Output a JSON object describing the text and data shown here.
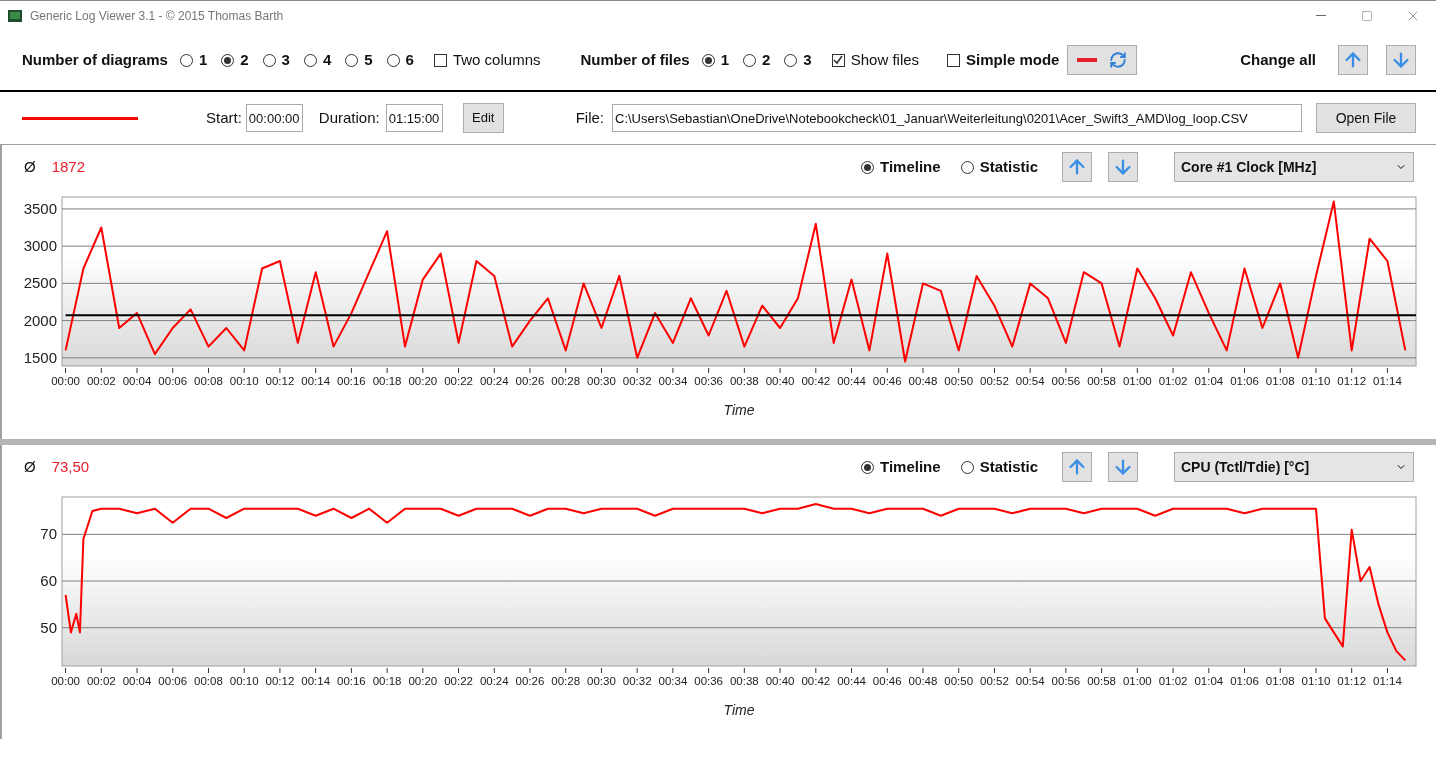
{
  "window": {
    "title": "Generic Log Viewer 3.1 - © 2015 Thomas Barth"
  },
  "toolbar": {
    "diagrams": {
      "label": "Number of diagrams",
      "options": [
        {
          "label": "1",
          "selected": false
        },
        {
          "label": "2",
          "selected": true
        },
        {
          "label": "3",
          "selected": false
        },
        {
          "label": "4",
          "selected": false
        },
        {
          "label": "5",
          "selected": false
        },
        {
          "label": "6",
          "selected": false
        }
      ]
    },
    "two_columns": {
      "label": "Two columns",
      "checked": false
    },
    "files": {
      "label": "Number of files",
      "options": [
        {
          "label": "1",
          "selected": true
        },
        {
          "label": "2",
          "selected": false
        },
        {
          "label": "3",
          "selected": false
        }
      ]
    },
    "show_files": {
      "label": "Show files",
      "checked": true
    },
    "simple_mode": {
      "label": "Simple mode",
      "checked": false
    },
    "change_all": {
      "label": "Change all"
    }
  },
  "file": {
    "color": "#ff0000",
    "start_label": "Start:",
    "start": "00:00:00",
    "duration_label": "Duration:",
    "duration": "01:15:00",
    "edit_button": "Edit",
    "file_label": "File:",
    "path": "C:\\Users\\Sebastian\\OneDrive\\Notebookcheck\\01_Januar\\Weiterleitung\\0201\\Acer_Swift3_AMD\\log_loop.CSV",
    "open_button": "Open File"
  },
  "diagrams": [
    {
      "average_symbol": "Ø",
      "average": "1872",
      "views": [
        {
          "label": "Timeline",
          "selected": true
        },
        {
          "label": "Statistic",
          "selected": false
        }
      ],
      "chart_data": {
        "type": "line",
        "xlabel": "Time",
        "xlim": [
          -0.2,
          75.6
        ],
        "ylim": [
          1390,
          3660
        ],
        "yticks": [
          1500,
          2000,
          2500,
          3000,
          3500
        ],
        "xticks": [
          {
            "value": 0,
            "label": "00:00"
          },
          {
            "value": 2,
            "label": "00:02"
          },
          {
            "value": 4,
            "label": "00:04"
          },
          {
            "value": 6,
            "label": "00:06"
          },
          {
            "value": 8,
            "label": "00:08"
          },
          {
            "value": 10,
            "label": "00:10"
          },
          {
            "value": 12,
            "label": "00:12"
          },
          {
            "value": 14,
            "label": "00:14"
          },
          {
            "value": 16,
            "label": "00:16"
          },
          {
            "value": 18,
            "label": "00:18"
          },
          {
            "value": 20,
            "label": "00:20"
          },
          {
            "value": 22,
            "label": "00:22"
          },
          {
            "value": 24,
            "label": "00:24"
          },
          {
            "value": 26,
            "label": "00:26"
          },
          {
            "value": 28,
            "label": "00:28"
          },
          {
            "value": 30,
            "label": "00:30"
          },
          {
            "value": 32,
            "label": "00:32"
          },
          {
            "value": 34,
            "label": "00:34"
          },
          {
            "value": 36,
            "label": "00:36"
          },
          {
            "value": 38,
            "label": "00:38"
          },
          {
            "value": 40,
            "label": "00:40"
          },
          {
            "value": 42,
            "label": "00:42"
          },
          {
            "value": 44,
            "label": "00:44"
          },
          {
            "value": 46,
            "label": "00:46"
          },
          {
            "value": 48,
            "label": "00:48"
          },
          {
            "value": 50,
            "label": "00:50"
          },
          {
            "value": 52,
            "label": "00:52"
          },
          {
            "value": 54,
            "label": "00:54"
          },
          {
            "value": 56,
            "label": "00:56"
          },
          {
            "value": 58,
            "label": "00:58"
          },
          {
            "value": 60,
            "label": "01:00"
          },
          {
            "value": 62,
            "label": "01:02"
          },
          {
            "value": 64,
            "label": "01:04"
          },
          {
            "value": 66,
            "label": "01:06"
          },
          {
            "value": 68,
            "label": "01:08"
          },
          {
            "value": 70,
            "label": "01:10"
          },
          {
            "value": 72,
            "label": "01:12"
          },
          {
            "value": 74,
            "label": "01:14"
          }
        ],
        "x": [
          0,
          1,
          2,
          3,
          4,
          5,
          6,
          7,
          8,
          9,
          10,
          11,
          12,
          13,
          14,
          15,
          16,
          17,
          18,
          19,
          20,
          21,
          22,
          23,
          24,
          25,
          26,
          27,
          28,
          29,
          30,
          31,
          32,
          33,
          34,
          35,
          36,
          37,
          38,
          39,
          40,
          41,
          42,
          43,
          44,
          45,
          46,
          47,
          48,
          49,
          50,
          51,
          52,
          53,
          54,
          55,
          56,
          57,
          58,
          59,
          60,
          61,
          62,
          63,
          64,
          65,
          66,
          67,
          68,
          69,
          70,
          71,
          72,
          73,
          74,
          75
        ],
        "series": [
          {
            "name": "Core #1 Clock [MHz]",
            "color": "#ff0000",
            "values": [
              1600,
              2700,
              3250,
              1900,
              2100,
              1550,
              1900,
              2150,
              1650,
              1900,
              1600,
              2700,
              2800,
              1700,
              2650,
              1650,
              2100,
              2650,
              3200,
              1650,
              2550,
              2900,
              1700,
              2800,
              2600,
              1650,
              2000,
              2300,
              1600,
              2500,
              1900,
              2600,
              1500,
              2100,
              1700,
              2300,
              1800,
              2400,
              1650,
              2200,
              1900,
              2300,
              3300,
              1700,
              2550,
              1600,
              2900,
              1450,
              2500,
              2400,
              1600,
              2600,
              2200,
              1650,
              2500,
              2300,
              1700,
              2650,
              2500,
              1650,
              2700,
              2300,
              1800,
              2650,
              2100,
              1600,
              2700,
              1900,
              2500,
              1500,
              2600,
              3600,
              1600,
              3100,
              2800,
              1600
            ]
          }
        ],
        "grid": true,
        "ref_lines": [
          {
            "axis": "y",
            "value": 2070,
            "color": "#000000"
          }
        ]
      }
    },
    {
      "average_symbol": "Ø",
      "average": "73,50",
      "views": [
        {
          "label": "Timeline",
          "selected": true
        },
        {
          "label": "Statistic",
          "selected": false
        }
      ],
      "chart_data": {
        "type": "line",
        "xlabel": "Time",
        "xlim": [
          -0.2,
          75.6
        ],
        "ylim": [
          41.8,
          78
        ],
        "yticks": [
          50,
          60,
          70
        ],
        "grid": true,
        "xticks": [
          {
            "value": 0,
            "label": "00:00"
          },
          {
            "value": 2,
            "label": "00:02"
          },
          {
            "value": 4,
            "label": "00:04"
          },
          {
            "value": 6,
            "label": "00:06"
          },
          {
            "value": 8,
            "label": "00:08"
          },
          {
            "value": 10,
            "label": "00:10"
          },
          {
            "value": 12,
            "label": "00:12"
          },
          {
            "value": 14,
            "label": "00:14"
          },
          {
            "value": 16,
            "label": "00:16"
          },
          {
            "value": 18,
            "label": "00:18"
          },
          {
            "value": 20,
            "label": "00:20"
          },
          {
            "value": 22,
            "label": "00:22"
          },
          {
            "value": 24,
            "label": "00:24"
          },
          {
            "value": 26,
            "label": "00:26"
          },
          {
            "value": 28,
            "label": "00:28"
          },
          {
            "value": 30,
            "label": "00:30"
          },
          {
            "value": 32,
            "label": "00:32"
          },
          {
            "value": 34,
            "label": "00:34"
          },
          {
            "value": 36,
            "label": "00:36"
          },
          {
            "value": 38,
            "label": "00:38"
          },
          {
            "value": 40,
            "label": "00:40"
          },
          {
            "value": 42,
            "label": "00:42"
          },
          {
            "value": 44,
            "label": "00:44"
          },
          {
            "value": 46,
            "label": "00:46"
          },
          {
            "value": 48,
            "label": "00:48"
          },
          {
            "value": 50,
            "label": "00:50"
          },
          {
            "value": 52,
            "label": "00:52"
          },
          {
            "value": 54,
            "label": "00:54"
          },
          {
            "value": 56,
            "label": "00:56"
          },
          {
            "value": 58,
            "label": "00:58"
          },
          {
            "value": 60,
            "label": "01:00"
          },
          {
            "value": 62,
            "label": "01:02"
          },
          {
            "value": 64,
            "label": "01:04"
          },
          {
            "value": 66,
            "label": "01:06"
          },
          {
            "value": 68,
            "label": "01:08"
          },
          {
            "value": 70,
            "label": "01:10"
          },
          {
            "value": 72,
            "label": "01:12"
          },
          {
            "value": 74,
            "label": "01:14"
          }
        ],
        "x": [
          0,
          0.3,
          0.6,
          0.8,
          1,
          1.5,
          2,
          3,
          4,
          5,
          6,
          7,
          8,
          9,
          10,
          11,
          12,
          13,
          14,
          15,
          16,
          17,
          18,
          19,
          20,
          21,
          22,
          23,
          24,
          25,
          26,
          27,
          28,
          29,
          30,
          31,
          32,
          33,
          34,
          35,
          36,
          37,
          38,
          39,
          40,
          41,
          42,
          43,
          44,
          45,
          46,
          47,
          48,
          49,
          50,
          51,
          52,
          53,
          54,
          55,
          56,
          57,
          58,
          59,
          60,
          61,
          62,
          63,
          64,
          65,
          66,
          67,
          68,
          69,
          70,
          70.5,
          71,
          71.5,
          72,
          72.5,
          73,
          73.5,
          74,
          74.5,
          75
        ],
        "series": [
          {
            "name": "CPU (Tctl/Tdie) [°C]",
            "color": "#ff0000",
            "values": [
              57,
              49,
              53,
              49,
              69,
              75,
              75.5,
              75.5,
              74.5,
              75.5,
              72.5,
              75.5,
              75.5,
              73.5,
              75.5,
              75.5,
              75.5,
              75.5,
              74,
              75.5,
              73.5,
              75.5,
              72.5,
              75.5,
              75.5,
              75.5,
              74,
              75.5,
              75.5,
              75.5,
              74,
              75.5,
              75.5,
              74.5,
              75.5,
              75.5,
              75.5,
              74,
              75.5,
              75.5,
              75.5,
              75.5,
              75.5,
              74.5,
              75.5,
              75.5,
              76.5,
              75.5,
              75.5,
              74.5,
              75.5,
              75.5,
              75.5,
              74,
              75.5,
              75.5,
              75.5,
              74.5,
              75.5,
              75.5,
              75.5,
              74.5,
              75.5,
              75.5,
              75.5,
              74,
              75.5,
              75.5,
              75.5,
              75.5,
              74.5,
              75.5,
              75.5,
              75.5,
              75.5,
              52,
              49,
              46,
              71,
              60,
              63,
              55,
              49,
              45,
              43
            ]
          }
        ]
      }
    }
  ]
}
